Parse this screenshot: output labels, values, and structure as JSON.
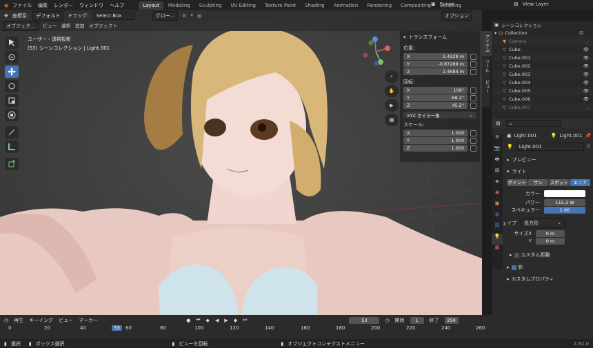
{
  "topbar": {
    "menus": [
      "ファイル",
      "編集",
      "レンダー",
      "ウィンドウ",
      "ヘルプ"
    ],
    "workspaces": [
      "Layout",
      "Modeling",
      "Sculpting",
      "UV Editing",
      "Texture Paint",
      "Shading",
      "Animation",
      "Rendering",
      "Compositing",
      "Scripting"
    ],
    "active_workspace": "Layout",
    "scene": "Scene",
    "view_layer": "View Layer"
  },
  "tool_header": {
    "mode_label": "座標系:",
    "orientation": "デフォルト",
    "drag_label": "ドラッグ:",
    "drag_value": "Select Box",
    "global": "グロー...",
    "options": "オプション"
  },
  "viewport": {
    "mode": "オブジェク...",
    "menus": [
      "ビュー",
      "選択",
      "追加",
      "オブジェクト"
    ],
    "title": "ユーザー・透視投影",
    "subtitle": "(53) シーンコレクション | Light.001"
  },
  "npanel": {
    "title": "トランスフォーム",
    "location_label": "位置:",
    "location": [
      {
        "axis": "X",
        "value": "1.4228 m"
      },
      {
        "axis": "Y",
        "value": "-0.87289 m"
      },
      {
        "axis": "Z",
        "value": "2.4684 m"
      }
    ],
    "rotation_label": "回転:",
    "rotation": [
      {
        "axis": "X",
        "value": "108°"
      },
      {
        "axis": "Y",
        "value": "-68.2°"
      },
      {
        "axis": "Z",
        "value": "45.2°"
      }
    ],
    "rotation_mode": "XYZ オイラー角",
    "scale_label": "スケール:",
    "scale": [
      {
        "axis": "X",
        "value": "1.000"
      },
      {
        "axis": "Y",
        "value": "1.000"
      },
      {
        "axis": "Z",
        "value": "1.000"
      }
    ],
    "tabs": [
      "アイテム",
      "ツール",
      "ビュー"
    ]
  },
  "outliner": {
    "title": "シーンコレクション",
    "collection": "Collection",
    "items": [
      "Camera",
      "Cube",
      "Cube.001",
      "Cube.002",
      "Cube.003",
      "Cube.004",
      "Cube.005",
      "Cube.006",
      "Cube.007"
    ]
  },
  "properties": {
    "object_name": "Light.001",
    "data_name": "Light.001",
    "datablock": "Light.001",
    "preview_label": "プレビュー",
    "light_label": "ライト",
    "types": [
      "ポイント",
      "サン",
      "スポット",
      "エリア"
    ],
    "active_type": "エリア",
    "color_label": "カラー",
    "color": "#ffffff",
    "power_label": "パワー",
    "power": "115.2 W",
    "specular_label": "スペキュラー",
    "specular": "1.00",
    "shape_label": "シェイプ",
    "shape": "長方形",
    "sizex_label": "サイズX",
    "sizex": "0 m",
    "y_label": "Y",
    "y": "0 m",
    "custom_dist": "カスタム距離",
    "shadow": "影",
    "custom_props": "カスタムプロパティ"
  },
  "timeline": {
    "menus": [
      "再生",
      "キーイング",
      "ビュー",
      "マーカー"
    ],
    "current_frame": "53",
    "start_label": "開始",
    "start": "1",
    "end_label": "終了",
    "end": "250",
    "ticks": [
      "0",
      "20",
      "40",
      "60",
      "80",
      "100",
      "120",
      "140",
      "160",
      "180",
      "200",
      "220",
      "240",
      "260"
    ]
  },
  "status": {
    "select": "選択",
    "box_select": "ボックス選択",
    "rotate_view": "ビューを回転",
    "context_menu": "オブジェクトコンテクストメニュー",
    "version": "2.92.0"
  }
}
